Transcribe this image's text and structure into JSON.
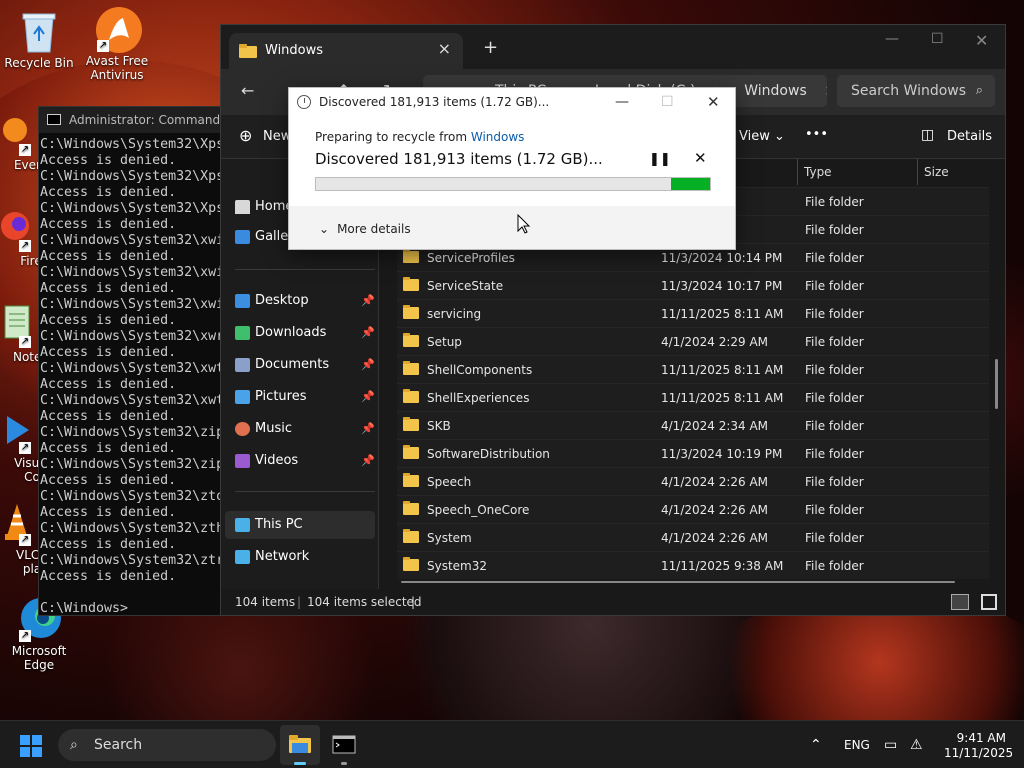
{
  "desktop": {
    "icons": [
      {
        "label": "Recycle Bin"
      },
      {
        "label": "Avast Free Antivirus"
      },
      {
        "label": "Every"
      },
      {
        "label": "Fire"
      },
      {
        "label": "Notep"
      },
      {
        "label": "Visual Co"
      },
      {
        "label": "VLC r pla"
      },
      {
        "label": "Microsoft Edge"
      }
    ]
  },
  "cmd": {
    "title": "Administrator: Command Prompt",
    "lines": "C:\\Windows\\System32\\Xps\nAccess is denied.\nC:\\Windows\\System32\\Xps\nAccess is denied.\nC:\\Windows\\System32\\Xps\nAccess is denied.\nC:\\Windows\\System32\\xwi\nAccess is denied.\nC:\\Windows\\System32\\xwi\nAccess is denied.\nC:\\Windows\\System32\\xwi\nAccess is denied.\nC:\\Windows\\System32\\xwr\nAccess is denied.\nC:\\Windows\\System32\\xwt\nAccess is denied.\nC:\\Windows\\System32\\xwt\nAccess is denied.\nC:\\Windows\\System32\\zip\nAccess is denied.\nC:\\Windows\\System32\\zip\nAccess is denied.\nC:\\Windows\\System32\\zto\nAccess is denied.\nC:\\Windows\\System32\\zth\nAccess is denied.\nC:\\Windows\\System32\\ztr\nAccess is denied.\n\nC:\\Windows>"
  },
  "explorer": {
    "tab_label": "Windows",
    "new_tab": "+",
    "address": [
      "This PC",
      ">",
      "Local Disk (C:)",
      ">",
      "Windows",
      ">"
    ],
    "search_placeholder": "Search Windows",
    "toolbar": {
      "new": "New",
      "view": "View",
      "more": "•••",
      "details": "Details"
    },
    "nav": {
      "home": "Home",
      "gallery": "Gallery",
      "quick": [
        {
          "label": "Desktop",
          "color": "#3c8fe0"
        },
        {
          "label": "Downloads",
          "color": "#3fbf6b"
        },
        {
          "label": "Documents",
          "color": "#8aa0c8"
        },
        {
          "label": "Pictures",
          "color": "#4aa3e8"
        },
        {
          "label": "Music",
          "color": "#e07050"
        },
        {
          "label": "Videos",
          "color": "#9a5ad0"
        }
      ],
      "this_pc": "This PC",
      "network": "Network"
    },
    "columns": {
      "type": "Type",
      "size": "Size"
    },
    "rows": [
      {
        "name": "",
        "date": "AM",
        "type": "File folder"
      },
      {
        "name": "",
        "date": "AM",
        "type": "File folder"
      },
      {
        "name": "ServiceProfiles",
        "date": "11/3/2024 10:14 PM",
        "type": "File folder"
      },
      {
        "name": "ServiceState",
        "date": "11/3/2024 10:17 PM",
        "type": "File folder"
      },
      {
        "name": "servicing",
        "date": "11/11/2025 8:11 AM",
        "type": "File folder"
      },
      {
        "name": "Setup",
        "date": "4/1/2024 2:29 AM",
        "type": "File folder"
      },
      {
        "name": "ShellComponents",
        "date": "11/11/2025 8:11 AM",
        "type": "File folder"
      },
      {
        "name": "ShellExperiences",
        "date": "11/11/2025 8:11 AM",
        "type": "File folder"
      },
      {
        "name": "SKB",
        "date": "4/1/2024 2:34 AM",
        "type": "File folder"
      },
      {
        "name": "SoftwareDistribution",
        "date": "11/3/2024 10:19 PM",
        "type": "File folder"
      },
      {
        "name": "Speech",
        "date": "4/1/2024 2:26 AM",
        "type": "File folder"
      },
      {
        "name": "Speech_OneCore",
        "date": "4/1/2024 2:26 AM",
        "type": "File folder"
      },
      {
        "name": "System",
        "date": "4/1/2024 2:26 AM",
        "type": "File folder"
      },
      {
        "name": "System32",
        "date": "11/11/2025 9:38 AM",
        "type": "File folder"
      }
    ],
    "status": {
      "items": "104 items",
      "selected": "104 items selected"
    }
  },
  "dialog": {
    "title": "Discovered 181,913 items (1.72 GB)...",
    "preparing": "Preparing to recycle from",
    "source": "Windows",
    "discovered": "Discovered 181,913 items (1.72 GB)...",
    "progress": 0.9,
    "more_details": "More details"
  },
  "taskbar": {
    "search": "Search",
    "lang": "ENG",
    "time": "9:41 AM",
    "date": "11/11/2025"
  }
}
